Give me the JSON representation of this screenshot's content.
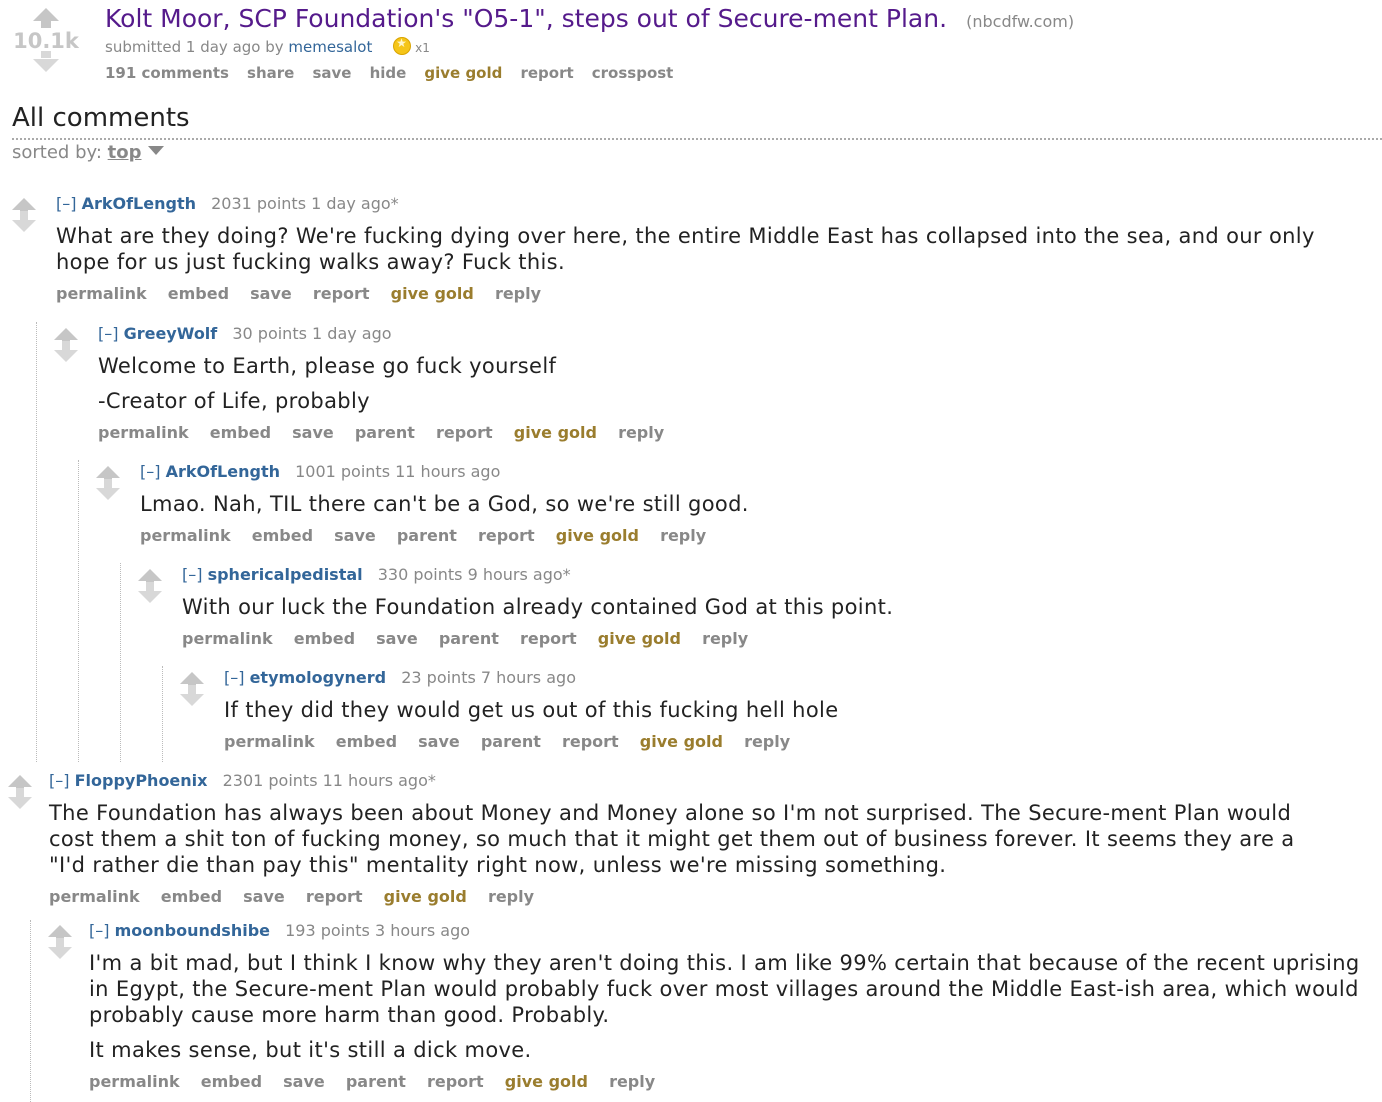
{
  "post": {
    "score": "10.1k",
    "title": "Kolt Moor, SCP Foundation's \"O5-1\", steps out of Secure-ment Plan.",
    "domain": "(nbcdfw.com)",
    "submitted_prefix": "submitted 1 day ago by",
    "author": "memesalot",
    "gilded_count": "x1",
    "buttons": [
      "191 comments",
      "share",
      "save",
      "hide",
      "give gold",
      "report",
      "crosspost"
    ]
  },
  "comments_area": {
    "title": "All comments",
    "sorted_by_label": "sorted by:",
    "sort_value": "top"
  },
  "comment_buttons": {
    "permalink": "permalink",
    "embed": "embed",
    "save": "save",
    "parent": "parent",
    "report": "report",
    "give_gold": "give gold",
    "reply": "reply"
  },
  "comments": [
    {
      "expand": "[–]",
      "author": "ArkOfLength",
      "meta": "2031 points 1 day ago*",
      "paragraphs": [
        "What are they doing? We're fucking dying over here, the entire Middle East has collapsed into the sea, and our only hope for us just fucking walks away? Fuck this."
      ]
    },
    {
      "expand": "[–]",
      "author": "GreeyWolf",
      "meta": "30 points 1 day ago",
      "paragraphs": [
        "Welcome to Earth, please go fuck yourself",
        "-Creator of Life, probably"
      ]
    },
    {
      "expand": "[–]",
      "author": "ArkOfLength",
      "meta": "1001 points 11 hours ago",
      "paragraphs": [
        "Lmao. Nah, TIL there can't be a God, so we're still good."
      ]
    },
    {
      "expand": "[–]",
      "author": "sphericalpedistal",
      "meta": "330 points 9 hours ago*",
      "paragraphs": [
        "With our luck the Foundation already contained God at this point."
      ]
    },
    {
      "expand": "[–]",
      "author": "etymologynerd",
      "meta": "23 points 7 hours ago",
      "paragraphs": [
        "If they did they would get us out of this fucking hell hole"
      ]
    },
    {
      "expand": "[–]",
      "author": "FloppyPhoenix",
      "meta": "2301 points 11 hours ago*",
      "paragraphs": [
        "The Foundation has always been about Money and Money alone so I'm not surprised. The Secure-ment Plan would cost them a shit ton of fucking money, so much that it might get them out of business forever. It seems they are a \"I'd rather die than pay this\" mentality right now, unless we're missing something."
      ]
    },
    {
      "expand": "[–]",
      "author": "moonboundshibe",
      "meta": "193 points 3 hours ago",
      "paragraphs": [
        "I'm a bit mad, but I think I know why they aren't doing this. I am like 99% certain that because of the recent uprising in Egypt, the Secure-ment Plan would probably fuck over most villages around the Middle East-ish area, which would probably cause more harm than good. Probably.",
        "It makes sense, but it's still a dick move."
      ]
    }
  ],
  "colors": {
    "title": "#551a8b",
    "link": "#336699",
    "gold": "#9a7d2e",
    "muted": "#888888"
  }
}
